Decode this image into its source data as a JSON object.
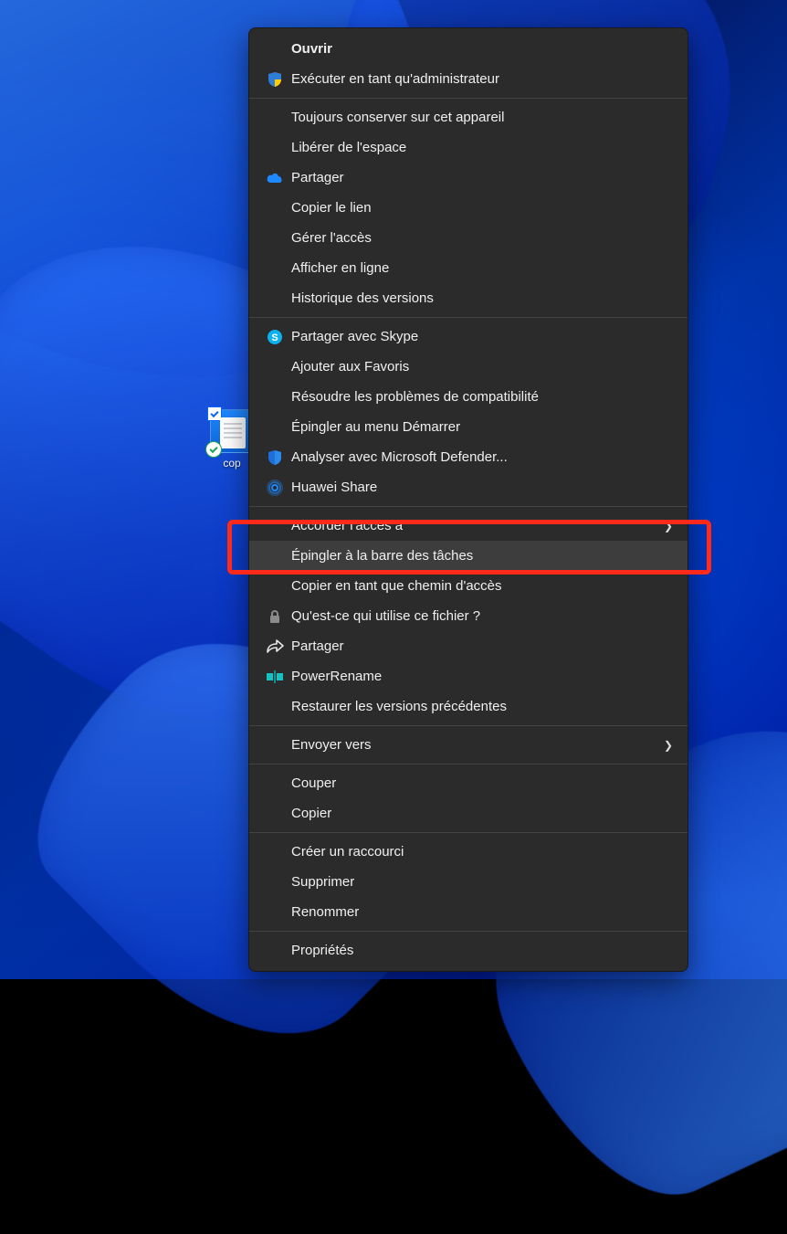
{
  "desktop_icon": {
    "label": "cop"
  },
  "menu": {
    "open": "Ouvrir",
    "run_admin": "Exécuter en tant qu'administrateur",
    "always_keep": "Toujours conserver sur cet appareil",
    "free_space": "Libérer de l'espace",
    "share_onedrive": "Partager",
    "copy_link": "Copier le lien",
    "manage_access": "Gérer l'accès",
    "view_online": "Afficher en ligne",
    "version_history": "Historique des versions",
    "share_skype": "Partager avec Skype",
    "add_favorites": "Ajouter aux Favoris",
    "troubleshoot": "Résoudre les problèmes de compatibilité",
    "pin_start": "Épingler au menu Démarrer",
    "defender": "Analyser avec Microsoft Defender...",
    "huawei": "Huawei Share",
    "grant_access": "Accorder l'accès à",
    "pin_taskbar": "Épingler à la barre des tâches",
    "copy_path": "Copier en tant que chemin d'accès",
    "who_uses": "Qu'est-ce qui utilise ce fichier ?",
    "share": "Partager",
    "powerrename": "PowerRename",
    "restore_versions": "Restaurer les versions précédentes",
    "send_to": "Envoyer vers",
    "cut": "Couper",
    "copy": "Copier",
    "create_shortcut": "Créer un raccourci",
    "delete": "Supprimer",
    "rename": "Renommer",
    "properties": "Propriétés"
  }
}
